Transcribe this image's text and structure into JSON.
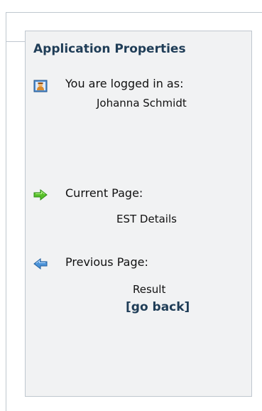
{
  "panel": {
    "title": "Application Properties",
    "logged_in": {
      "icon": "user-icon",
      "label": "You are logged in as:",
      "value": "Johanna Schmidt"
    },
    "current_page": {
      "icon": "arrow-right-icon",
      "label": "Current Page:",
      "value": "EST Details"
    },
    "previous_page": {
      "icon": "arrow-left-icon",
      "label": "Previous Page:",
      "value": "Result",
      "link": "[go back]"
    }
  },
  "colors": {
    "title": "#1f3d57",
    "panel_background": "#f1f2f3",
    "border": "#bfc7cf",
    "current_arrow": "#58c02a",
    "previous_arrow": "#4c93d8"
  }
}
